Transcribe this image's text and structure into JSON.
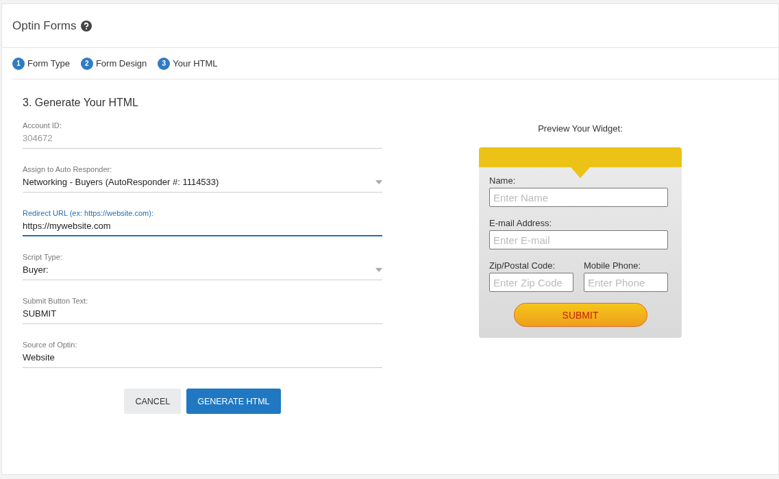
{
  "header": {
    "title": "Optin Forms"
  },
  "steps": [
    {
      "number": "1",
      "label": "Form Type"
    },
    {
      "number": "2",
      "label": "Form Design"
    },
    {
      "number": "3",
      "label": "Your HTML"
    }
  ],
  "form": {
    "heading": "3. Generate Your HTML",
    "fields": [
      {
        "kind": "text",
        "label": "Account ID:",
        "value": "304672",
        "disabled": true,
        "focused": false
      },
      {
        "kind": "select",
        "label": "Assign to Auto Responder:",
        "value": "Networking - Buyers (AutoResponder #: 1114533)",
        "disabled": false,
        "focused": false
      },
      {
        "kind": "text",
        "label": "Redirect URL (ex: https://website.com):",
        "value": "https://mywebsite.com",
        "disabled": false,
        "focused": true
      },
      {
        "kind": "select",
        "label": "Script Type:",
        "value": "Buyer:",
        "disabled": false,
        "focused": false
      },
      {
        "kind": "text",
        "label": "Submit Button Text:",
        "value": "SUBMIT",
        "disabled": false,
        "focused": false
      },
      {
        "kind": "text",
        "label": "Source of Optin:",
        "value": "Website",
        "disabled": false,
        "focused": false
      }
    ],
    "buttons": [
      {
        "kind": "secondary",
        "label": "CANCEL"
      },
      {
        "kind": "primary",
        "label": "GENERATE HTML"
      }
    ]
  },
  "preview": {
    "title": "Preview Your Widget:",
    "rows": [
      [
        {
          "label": "Name:",
          "placeholder": "Enter Name"
        }
      ],
      [
        {
          "label": "E-mail Address:",
          "placeholder": "Enter E-mail"
        }
      ],
      [
        {
          "label": "Zip/Postal Code:",
          "placeholder": "Enter Zip Code"
        },
        {
          "label": "Mobile Phone:",
          "placeholder": "Enter Phone"
        }
      ]
    ],
    "submit": "SUBMIT"
  }
}
